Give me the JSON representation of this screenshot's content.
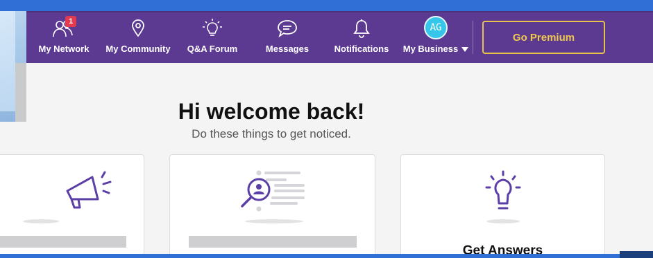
{
  "nav": {
    "items": [
      {
        "label": "My Network",
        "icon": "people-icon",
        "badge": "1"
      },
      {
        "label": "My Community",
        "icon": "map-pin-icon"
      },
      {
        "label": "Q&A Forum",
        "icon": "lightbulb-icon"
      },
      {
        "label": "Messages",
        "icon": "chat-bubble-icon"
      },
      {
        "label": "Notifications",
        "icon": "bell-icon"
      },
      {
        "label": "My Business",
        "icon": "avatar",
        "avatar_initials": "AG"
      }
    ],
    "premium_label": "Go Premium"
  },
  "welcome": {
    "title": "Hi welcome back!",
    "subtitle": "Do these things to get noticed."
  },
  "cards": [
    {
      "icon": "megaphone-icon",
      "title": ""
    },
    {
      "icon": "profile-search-icon",
      "title": ""
    },
    {
      "icon": "lightbulb-icon",
      "title": "Get Answers"
    }
  ],
  "colors": {
    "nav_bg": "#5c3a91",
    "top_bar": "#2f6fd6",
    "accent_purple": "#5b3ea6",
    "premium_gold": "#f0c84c",
    "badge_red": "#e23b4f",
    "avatar_cyan": "#35c6e9"
  }
}
